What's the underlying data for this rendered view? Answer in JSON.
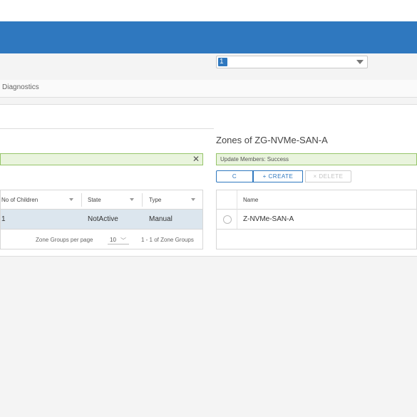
{
  "select": {
    "value": "1"
  },
  "tabs": {
    "diagnostics": "Diagnostics"
  },
  "zones_panel": {
    "title": "Zones of ZG-NVMe-SAN-A",
    "alert": "Update Members: Success",
    "buttons": {
      "refresh_icon": "C",
      "create": "+ CREATE",
      "delete": "× DELETE"
    },
    "columns": [
      "Name"
    ],
    "rows": [
      {
        "name": "Z-NVMe-SAN-A"
      }
    ]
  },
  "zone_groups": {
    "alert_close": "✕",
    "columns": [
      "No of Children",
      "State",
      "Type"
    ],
    "rows": [
      {
        "children": "1",
        "state": "NotActive",
        "type": "Manual"
      }
    ],
    "footer": {
      "per_page_label": "Zone Groups per page",
      "per_page_value": "10",
      "range": "1 - 1 of Zone Groups"
    }
  },
  "colors": {
    "header": "#2f78bf",
    "success_bg": "#e9f4dd",
    "success_border": "#96c46a",
    "row_selected": "#dce6ee"
  }
}
